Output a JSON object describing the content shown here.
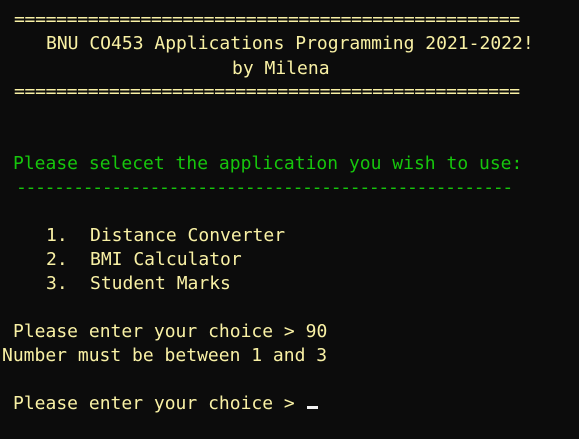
{
  "console": {
    "banner": {
      "rule_top": "================================================",
      "title": "BNU CO453 Applications Programming 2021-2022!",
      "author": "by Milena",
      "rule_bottom": "================================================"
    },
    "menu": {
      "heading": "Please selecet the application you wish to use:",
      "underline": "----------------------------------------------------",
      "items": [
        {
          "number": "1.",
          "label": "Distance Converter"
        },
        {
          "number": "2.",
          "label": "BMI Calculator"
        },
        {
          "number": "3.",
          "label": "Student Marks"
        }
      ]
    },
    "first_prompt": {
      "text": "Please enter your choice > ",
      "input": "90"
    },
    "error": "Number must be between 1 and 3",
    "second_prompt": {
      "text": "Please enter your choice > "
    },
    "colors": {
      "background": "#0c0c0c",
      "text_yellow": "#f9f1a5",
      "text_green": "#16c60c",
      "cursor": "#f2f2f2"
    }
  }
}
